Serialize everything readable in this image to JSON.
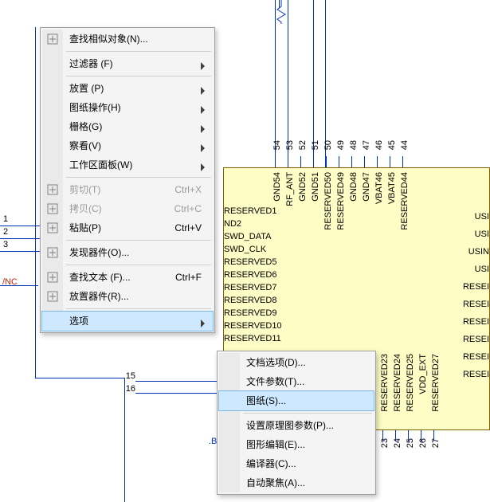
{
  "menu": {
    "items": [
      {
        "label": "查找相似对象(N)...",
        "hasIcon": true
      },
      {
        "label": "过滤器 (F)",
        "submenu": true
      },
      {
        "label": "放置 (P)",
        "submenu": true
      },
      {
        "label": "图纸操作(H)",
        "submenu": true
      },
      {
        "label": "栅格(G)",
        "submenu": true
      },
      {
        "label": "察看(V)",
        "submenu": true
      },
      {
        "label": "工作区面板(W)",
        "submenu": true
      },
      {
        "label": "剪切(T)",
        "shortcut": "Ctrl+X",
        "disabled": true,
        "hasIcon": true
      },
      {
        "label": "拷贝(C)",
        "shortcut": "Ctrl+C",
        "disabled": true,
        "hasIcon": true
      },
      {
        "label": "粘贴(P)",
        "shortcut": "Ctrl+V",
        "hasIcon": true
      },
      {
        "label": "发现器件(O)...",
        "hasIcon": true
      },
      {
        "label": "查找文本 (F)...",
        "shortcut": "Ctrl+F",
        "hasIcon": true
      },
      {
        "label": "放置器件(R)...",
        "hasIcon": true
      },
      {
        "label": "选项",
        "submenu": true,
        "hover": true
      }
    ]
  },
  "submenu": {
    "items": [
      {
        "label": "文档选项(D)..."
      },
      {
        "label": "文件参数(T)..."
      },
      {
        "label": "图纸(S)...",
        "hover": true
      },
      {
        "label": "设置原理图参数(P)..."
      },
      {
        "label": "图形编辑(E)..."
      },
      {
        "label": "编译器(C)..."
      },
      {
        "label": "自动聚焦(A)..."
      }
    ]
  },
  "schematic": {
    "leftPins": {
      "n1": "1",
      "n2": "2",
      "n3": "3"
    },
    "nc_label": "/NC",
    "midPinNums": {
      "n15": "15",
      "n16": "16"
    },
    "bo_label": ".BO",
    "rows": [
      "RESERVED1",
      "ND2",
      "SWD_DATA",
      "SWD_CLK",
      "RESERVED5",
      "RESERVED6",
      "RESERVED7",
      "RESERVED8",
      "RESERVED9",
      "RESERVED10",
      "RESERVED11"
    ],
    "rightRows": [
      "USI",
      "USI",
      "USIN",
      "USI",
      "RESEI",
      "RESEI",
      "RESEI",
      "RESEI",
      "RESEI",
      "RESEI"
    ],
    "topPins": [
      {
        "num": "54",
        "name": "GND54"
      },
      {
        "num": "53",
        "name": "RF_ANT"
      },
      {
        "num": "52",
        "name": "GND52"
      },
      {
        "num": "51",
        "name": "GND51"
      },
      {
        "num": "50",
        "name": "RESERVED50"
      },
      {
        "num": "49",
        "name": "RESERVED49"
      },
      {
        "num": "48",
        "name": "GND48"
      },
      {
        "num": "47",
        "name": "GND47"
      },
      {
        "num": "46",
        "name": "VBAT46"
      },
      {
        "num": "45",
        "name": "VBAT45"
      },
      {
        "num": "44",
        "name": "RESERVED44"
      }
    ],
    "bottomPins": [
      {
        "num": "23",
        "name": "RESERVED23"
      },
      {
        "num": "24",
        "name": "RESERVED24"
      },
      {
        "num": "25",
        "name": "RESERVED25"
      },
      {
        "num": "26",
        "name": "VDD_EXT"
      },
      {
        "num": "27",
        "name": "RESERVED27"
      }
    ]
  }
}
